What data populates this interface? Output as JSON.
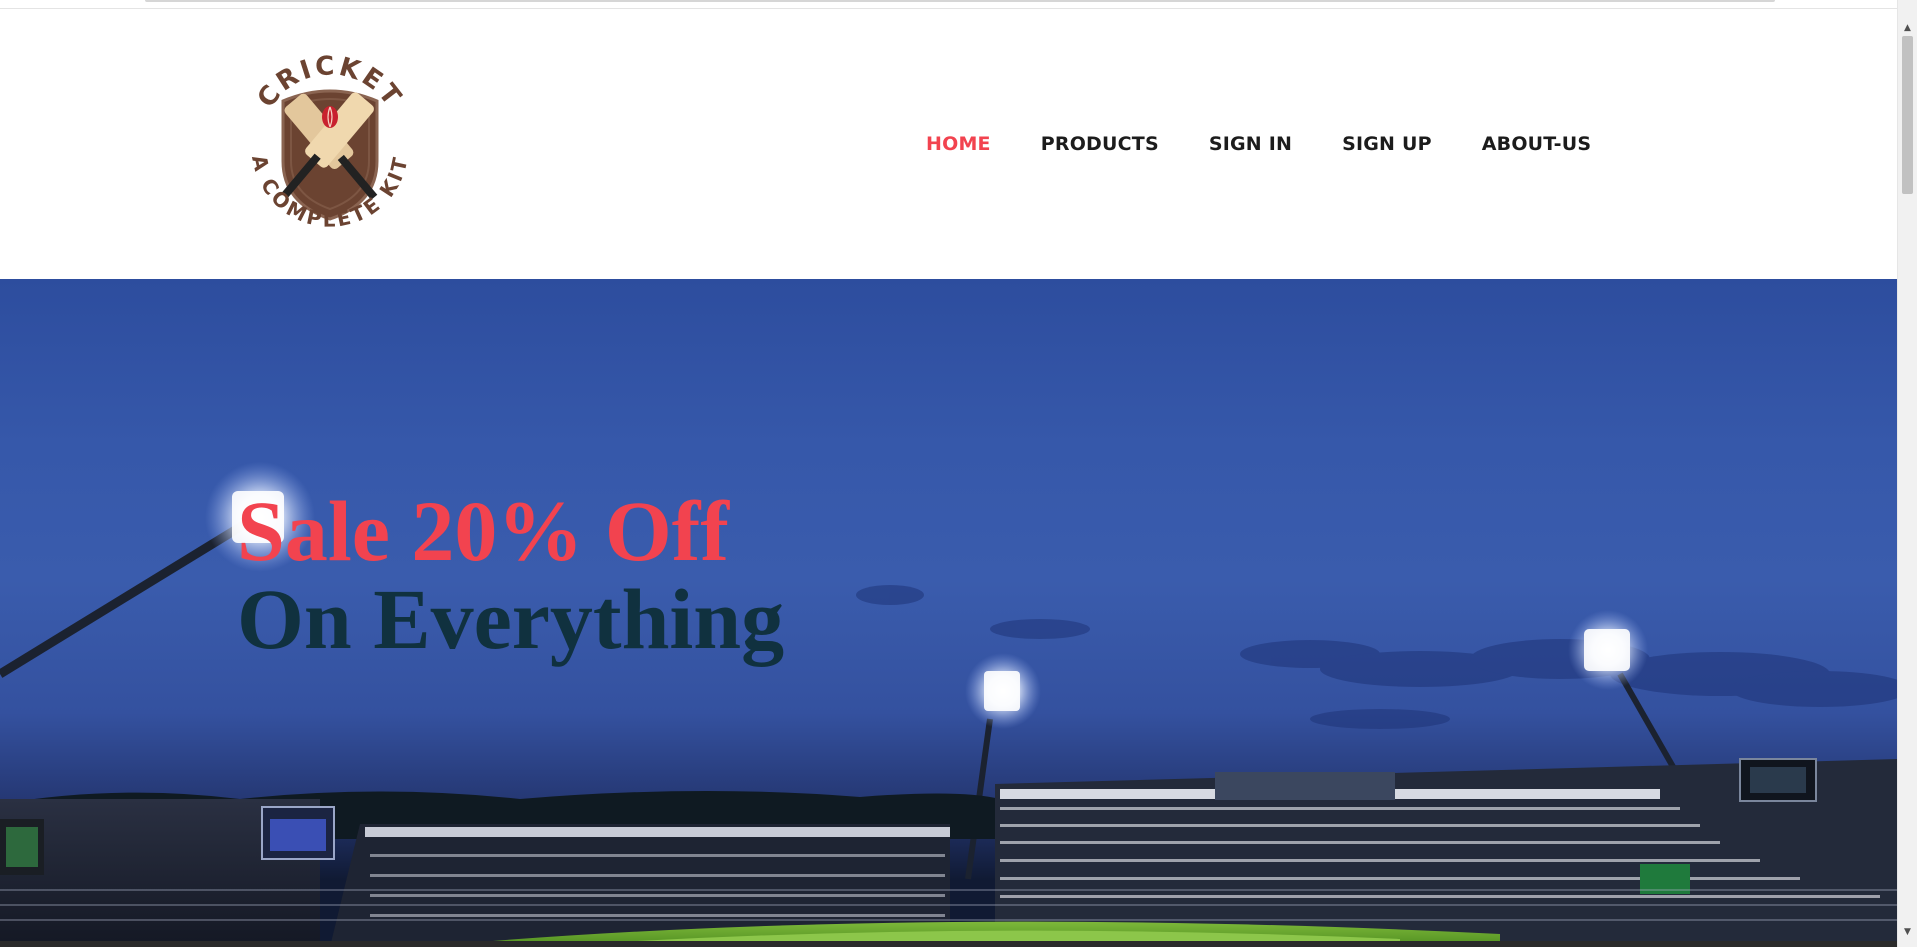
{
  "logo": {
    "top_text": "CRICKET",
    "bottom_text": "A COMPLETE KIT"
  },
  "nav": {
    "items": [
      {
        "label": "HOME",
        "active": true
      },
      {
        "label": "PRODUCTS",
        "active": false
      },
      {
        "label": "SIGN IN",
        "active": false
      },
      {
        "label": "SIGN UP",
        "active": false
      },
      {
        "label": "ABOUT-US",
        "active": false
      }
    ]
  },
  "hero": {
    "line1": "Sale 20% Off",
    "line2": "On Everything"
  },
  "colors": {
    "accent": "#f2434f",
    "dark_text": "#10313f",
    "nav_text": "#1c1c1c",
    "logo_brown": "#6b4331"
  },
  "scrollbar": {
    "up_icon": "chevron-up-icon",
    "down_icon": "chevron-down-icon"
  }
}
